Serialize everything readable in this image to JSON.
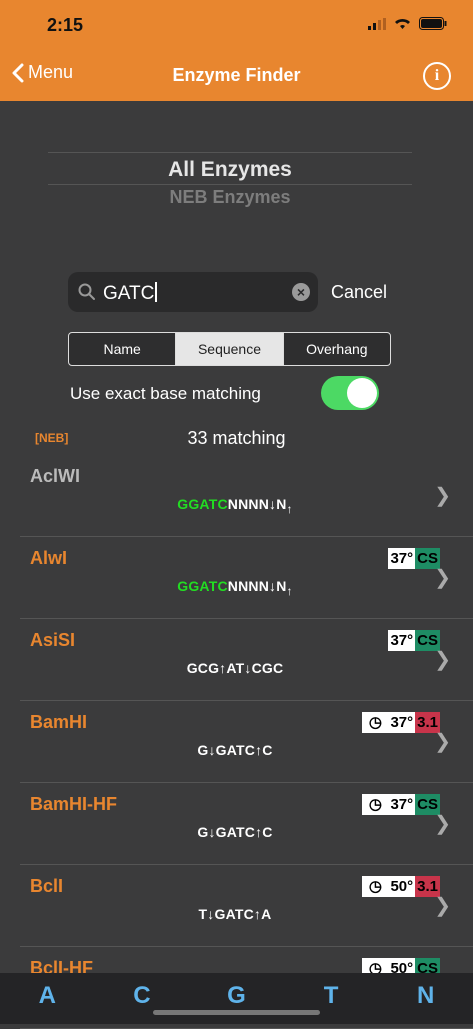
{
  "status": {
    "time": "2:15"
  },
  "nav": {
    "back_label": "Menu",
    "title": "Enzyme Finder"
  },
  "picker": {
    "selected": "All Enzymes",
    "next": "NEB Enzymes"
  },
  "search": {
    "value": "GATC",
    "cancel_label": "Cancel"
  },
  "segments": [
    {
      "label": "Name",
      "active": false
    },
    {
      "label": "Sequence",
      "active": true
    },
    {
      "label": "Overhang",
      "active": false
    }
  ],
  "exact_match": {
    "label": "Use exact base matching",
    "on": true
  },
  "results": {
    "neb_tag": "[NEB]",
    "count_label": "33 matching"
  },
  "enzymes": [
    {
      "name": "AclWI",
      "seq_green": "GGATC",
      "seq_rest": "NNNN↓N",
      "seq_up": "↑",
      "badges": []
    },
    {
      "name": "AlwI",
      "seq_green": "GGATC",
      "seq_rest": "NNNN↓N",
      "seq_up": "↑",
      "badges": [
        "37°",
        "CS"
      ]
    },
    {
      "name": "AsiSI",
      "seq": "GCG↑AT↓CGC",
      "badges": [
        "37°",
        "CS"
      ]
    },
    {
      "name": "BamHI",
      "seq": "G↓GATC↑C",
      "badges": [
        "37°",
        "3.1"
      ]
    },
    {
      "name": "BamHI-HF",
      "seq": "G↓GATC↑C",
      "badges": [
        "37°",
        "CS"
      ]
    },
    {
      "name": "BclI",
      "seq": "T↓GATC↑A",
      "badges": [
        "50°",
        "3.1"
      ]
    },
    {
      "name": "BclI-HF",
      "seq": "",
      "badges": [
        "50°",
        "CS"
      ]
    }
  ],
  "bases": [
    "A",
    "C",
    "G",
    "T",
    "N"
  ]
}
